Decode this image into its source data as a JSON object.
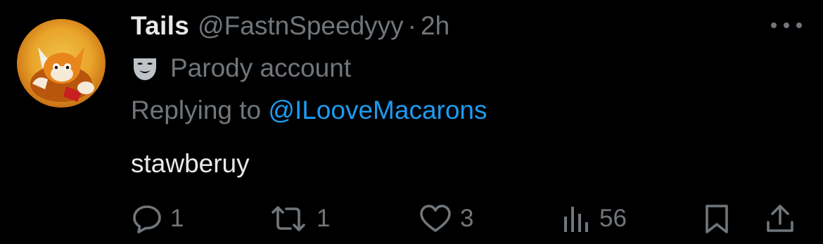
{
  "tweet": {
    "display_name": "Tails",
    "handle": "@FastnSpeedyyy",
    "separator": "·",
    "time": "2h",
    "label": "Parody account",
    "replying_prefix": "Replying to ",
    "replying_to": "@ILooveMacarons",
    "text": "stawberuy"
  },
  "actions": {
    "replies": "1",
    "reposts": "1",
    "likes": "3",
    "views": "56"
  },
  "icons": {
    "more": "more-horizontal-icon",
    "label": "theater-mask-icon",
    "reply": "reply-bubble-icon",
    "repost": "repost-icon",
    "like": "heart-icon",
    "views": "views-chart-icon",
    "bookmark": "bookmark-icon",
    "share": "share-icon"
  },
  "colors": {
    "background": "#000000",
    "primary_text": "#e7e9ea",
    "secondary_text": "#71767b",
    "link": "#1d9bf0",
    "avatar_orange": "#e9a52a"
  }
}
